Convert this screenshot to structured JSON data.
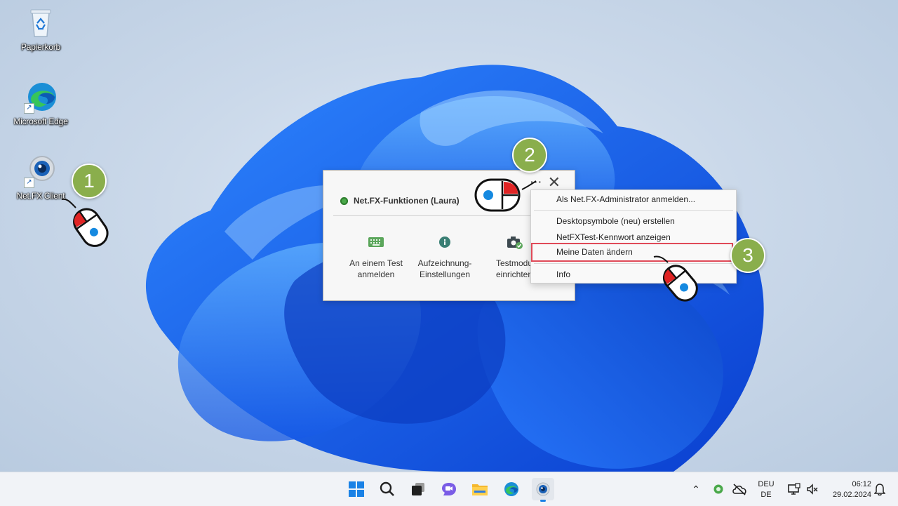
{
  "desktop": {
    "icons": [
      {
        "label": "Papierkorb",
        "icon": "recycle-bin-icon"
      },
      {
        "label": "Microsoft Edge",
        "icon": "edge-icon"
      },
      {
        "label": "Net.FX Client",
        "icon": "netfx-client-icon"
      }
    ]
  },
  "popup": {
    "title": "Net.FX-Funktionen (Laura)",
    "more_label": "···",
    "close_label": "✕",
    "functions": [
      {
        "line1": "An einem Test",
        "line2": "anmelden",
        "icon": "keyboard-icon"
      },
      {
        "line1": "Aufzeichnung-",
        "line2": "Einstellungen",
        "icon": "info-icon"
      },
      {
        "line1": "Testmodu",
        "line2": "einrichten",
        "icon": "camera-check-icon"
      }
    ]
  },
  "context_menu": {
    "items": [
      "Als Net.FX-Administrator anmelden...",
      "Desktopsymbole (neu) erstellen",
      "NetFXTest-Kennwort anzeigen",
      "Meine Daten ändern",
      "Info"
    ],
    "highlighted": "Meine Daten ändern"
  },
  "steps": [
    "1",
    "2",
    "3"
  ],
  "taskbar": {
    "apps": [
      "start-icon",
      "search-icon",
      "task-view-icon",
      "teams-chat-icon",
      "file-explorer-icon",
      "edge-icon",
      "netfx-client-icon"
    ],
    "tray": {
      "language_top": "DEU",
      "language_bottom": "DE",
      "time": "06:12",
      "date": "29.02.2024"
    }
  },
  "colors": {
    "badge": "#8aae4c",
    "highlight_border": "#e04a58",
    "wallpaper_blue": "#1a5fe0"
  }
}
